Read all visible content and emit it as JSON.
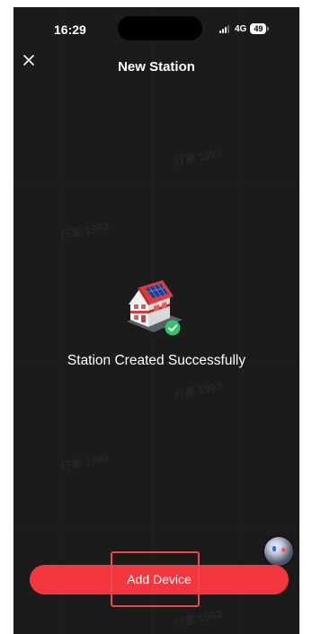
{
  "status_bar": {
    "time": "16:29",
    "network": "4G",
    "battery_level": "49"
  },
  "header": {
    "title": "New Station",
    "close_icon": "close-icon"
  },
  "main": {
    "illustration_icon": "solar-house-icon",
    "badge_icon": "check-badge-icon",
    "message": "Station Created Successfully"
  },
  "footer": {
    "add_device_label": "Add Device"
  },
  "watermark": "行家 1993",
  "colors": {
    "background": "#1b1b1b",
    "accent": "#f4363f",
    "success": "#2fc56a",
    "highlight": "#f0474c"
  }
}
